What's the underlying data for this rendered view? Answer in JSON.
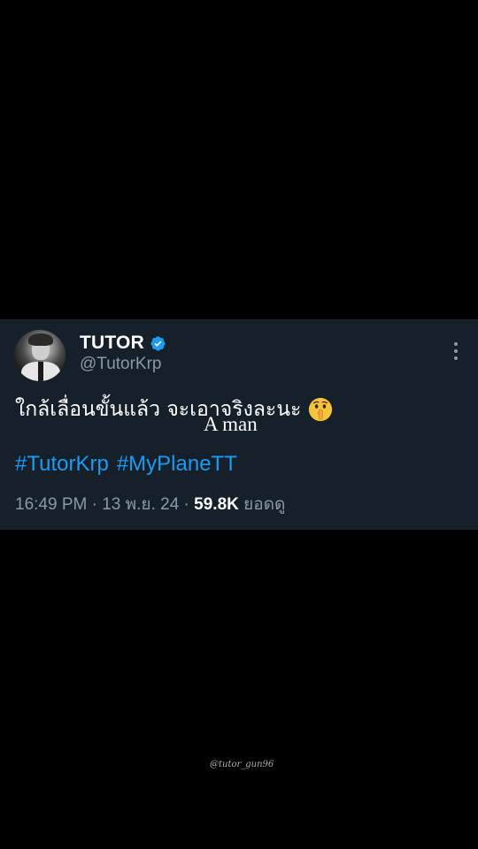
{
  "tweet": {
    "display_name": "TUTOR",
    "handle": "@TutorKrp",
    "verified_icon": "verified-badge-icon",
    "verified_color": "#1d9bf0",
    "avatar_icon": "profile-avatar",
    "text": "ใกล้เลื่อนขั้นแล้ว จะเอาจริงละนะ",
    "emoji": "shushing-face-emoji",
    "hashtags": [
      "#TutorKrp",
      "#MyPlaneTT"
    ],
    "time": "16:49 PM",
    "separator": "·",
    "date": "13 พ.ย. 24",
    "views_count": "59.8K",
    "views_label": "ยอดดู",
    "more_icon": "more-options-icon"
  },
  "overlay": {
    "caption": "A man",
    "watermark": "@tutor_gun96"
  },
  "colors": {
    "background": "#000000",
    "card": "#15202b",
    "accent": "#1d9bf0",
    "secondary_text": "#8b98a5"
  }
}
